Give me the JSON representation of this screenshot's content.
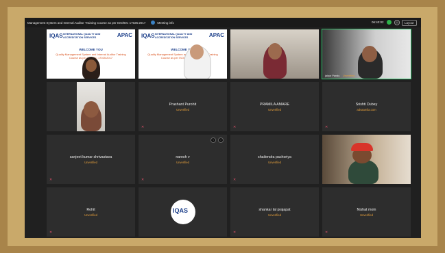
{
  "topbar": {
    "title": "Management System and Internal Auditor Training Course as per ISO/IEC 17025:2017",
    "meeting_info": "Meeting info",
    "time": "06:40:02",
    "layout_label": "Layout"
  },
  "slide": {
    "logo": "IQAS",
    "org_line1": "INTERNATIONAL QUALITY AND",
    "org_line2": "ACCREDITATION SERVICES",
    "apac": "APAC",
    "welcome": "WELCOME YOU",
    "course": "Quality Management System and Internal Auditor Training Course as per ISO/IEC 17025:2017"
  },
  "participants": [
    {
      "name": "",
      "status": ""
    },
    {
      "name": "",
      "status": ""
    },
    {
      "name": "",
      "status": ""
    },
    {
      "name": "jaipur Pandu",
      "status": "Unverified"
    },
    {
      "name": "",
      "status": ""
    },
    {
      "name": "Prashant Purohit",
      "status": "Unverified"
    },
    {
      "name": "PRAMILA AMARE",
      "status": "Unverified"
    },
    {
      "name": "Srishti Dubey",
      "status": "advaamila.com"
    },
    {
      "name": "sanjeet kumar shrivastava",
      "status": "Unverified"
    },
    {
      "name": "naresh v",
      "status": "Unverified"
    },
    {
      "name": "shailendra pachoriya",
      "status": "Unverified"
    },
    {
      "name": "",
      "status": ""
    },
    {
      "name": "Rohit",
      "status": "Unverified"
    },
    {
      "name": "",
      "status": ""
    },
    {
      "name": "shankar lal prajapat",
      "status": "Unverified"
    },
    {
      "name": "Nishat moin",
      "status": "Unverified"
    }
  ],
  "icons": {
    "mic_muted": "mic-off-icon",
    "shield": "shield-icon"
  },
  "colors": {
    "accent": "#31c46b",
    "unverified": "#e9a23b",
    "muted": "#e0506a",
    "frame": "#a8844a"
  }
}
